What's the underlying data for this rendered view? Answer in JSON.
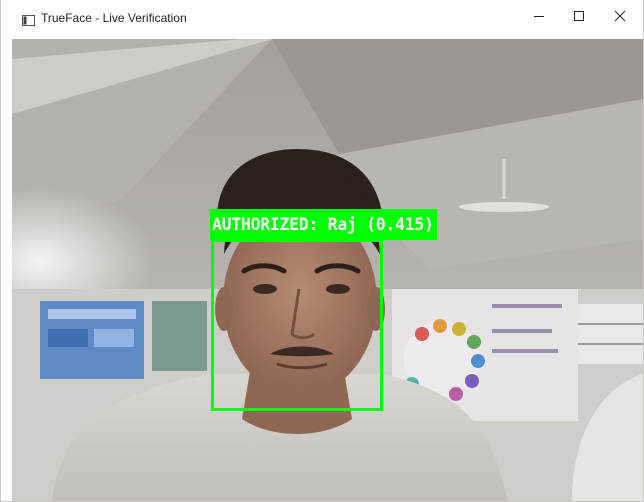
{
  "window": {
    "title": "TrueFace - Live Verification",
    "controls": {
      "minimize": "minimize-icon",
      "maximize": "maximize-icon",
      "close": "close-icon"
    }
  },
  "detection": {
    "label": "AUTHORIZED: Raj (0.415)",
    "name": "Raj",
    "status": "AUTHORIZED",
    "score": 0.415,
    "box_color": "#00ff00"
  }
}
